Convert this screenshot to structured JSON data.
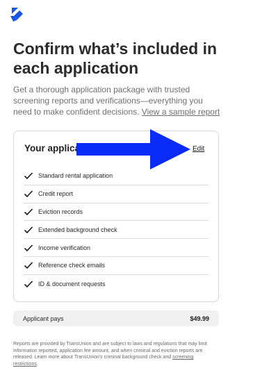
{
  "page": {
    "title": "Confirm what’s included in each application",
    "intro_text": "Get a thorough application package with trusted screening reports and verifications—everything you need to make confident decisions.",
    "sample_link": "View a sample report"
  },
  "card": {
    "title": "Your applicati",
    "edit_label": "Edit",
    "items": [
      {
        "label": "Standard rental application",
        "icon": "check-icon"
      },
      {
        "label": "Credit report",
        "icon": "check-icon"
      },
      {
        "label": "Eviction records",
        "icon": "check-icon"
      },
      {
        "label": "Extended background check",
        "icon": "check-icon"
      },
      {
        "label": "Income verification",
        "icon": "check-icon"
      },
      {
        "label": "Reference check emails",
        "icon": "check-icon"
      },
      {
        "label": "ID & document requests",
        "icon": "check-icon"
      }
    ]
  },
  "payment": {
    "label": "Applicant pays",
    "amount": "$49.99"
  },
  "disclaimer": {
    "text": "Reports are provided by TransUnion and are subject to laws and regulations that may limit information reported, application fee amount, and when criminal and eviction reports are released. Learn more about TransUnion’s criminal background check and",
    "link": "screening restrictions",
    "end": "."
  },
  "colors": {
    "brand_blue": "#1a56e8",
    "annotation_arrow": "#0a2bf5"
  }
}
